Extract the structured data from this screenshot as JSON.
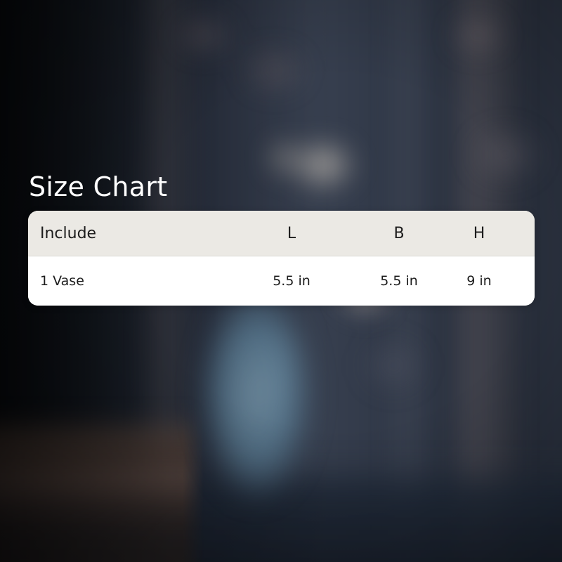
{
  "title": "Size Chart",
  "size_table": {
    "columns": [
      "Include",
      "L",
      "B",
      "H"
    ],
    "rows": [
      [
        "1 Vase",
        "5.5 in",
        "5.5 in",
        "9 in"
      ]
    ]
  },
  "colors": {
    "title_text": "#ffffff",
    "header_background": "#ebe9e4",
    "row_background": "#ffffff",
    "table_text": "#1c1c1c",
    "background_tone": "#2a3140"
  }
}
